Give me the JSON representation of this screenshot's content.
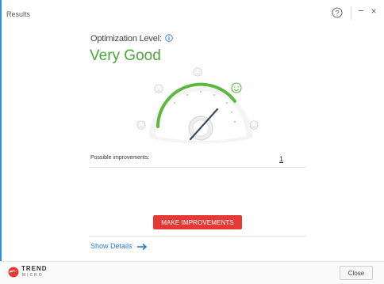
{
  "window": {
    "title": "Results",
    "help_icon": "help-icon",
    "minimize_label": "−",
    "close_label": "×"
  },
  "optimization": {
    "label": "Optimization Level:",
    "info_icon": "info-icon",
    "value": "Very Good",
    "value_color": "#4aa63a",
    "level": "Very Good"
  },
  "improvements": {
    "label": "Possible improvements:",
    "count": "1"
  },
  "actions": {
    "make_improvements": "MAKE IMPROVEMENTS",
    "show_details": "Show Details",
    "close": "Close"
  },
  "brand": {
    "name": "TREND",
    "sub": "MICRO",
    "accent": "#e53935"
  },
  "colors": {
    "accent": "#2a78d6",
    "good": "#4aa63a",
    "danger": "#e53935"
  }
}
